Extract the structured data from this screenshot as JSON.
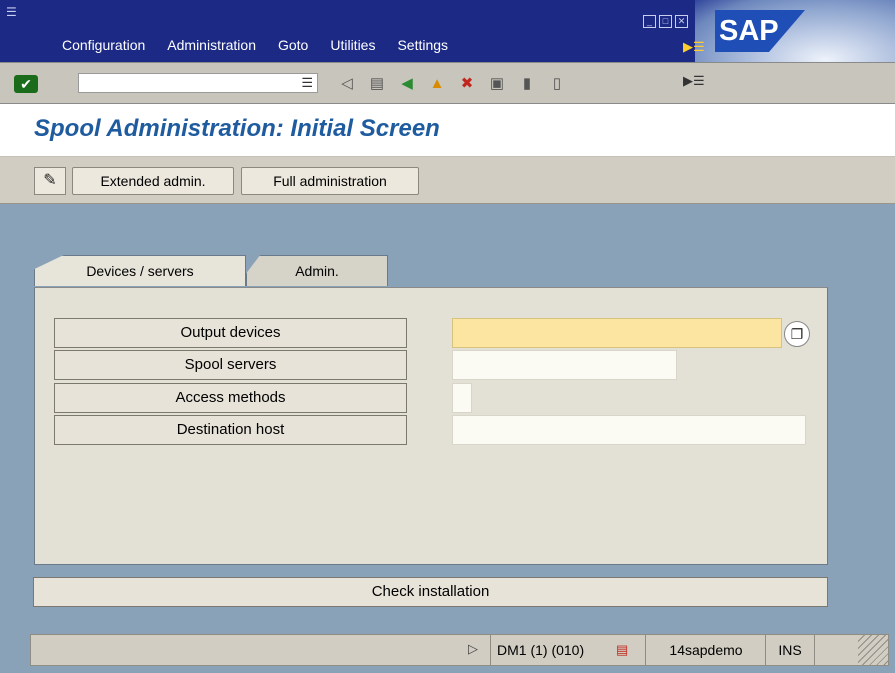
{
  "menubar": {
    "items": [
      "Configuration",
      "Administration",
      "Goto",
      "Utilities",
      "Settings"
    ],
    "logo_text": "SAP"
  },
  "toolbar": {
    "icons": [
      "back-icon",
      "save-icon",
      "green-back-icon",
      "exit-icon",
      "cancel-icon",
      "print-icon",
      "find-icon",
      "find-next-icon",
      "layout-icon"
    ]
  },
  "title": "Spool Administration: Initial Screen",
  "app_toolbar": {
    "extended_admin": "Extended admin.",
    "full_admin": "Full administration"
  },
  "tabs": {
    "active": "Devices / servers",
    "inactive": "Admin."
  },
  "rows": [
    {
      "label": "Output devices"
    },
    {
      "label": "Spool servers"
    },
    {
      "label": "Access methods"
    },
    {
      "label": "Destination host"
    }
  ],
  "check_button": "Check installation",
  "status": {
    "system": "DM1 (1) (010)",
    "server": "14sapdemo",
    "mode": "INS"
  }
}
